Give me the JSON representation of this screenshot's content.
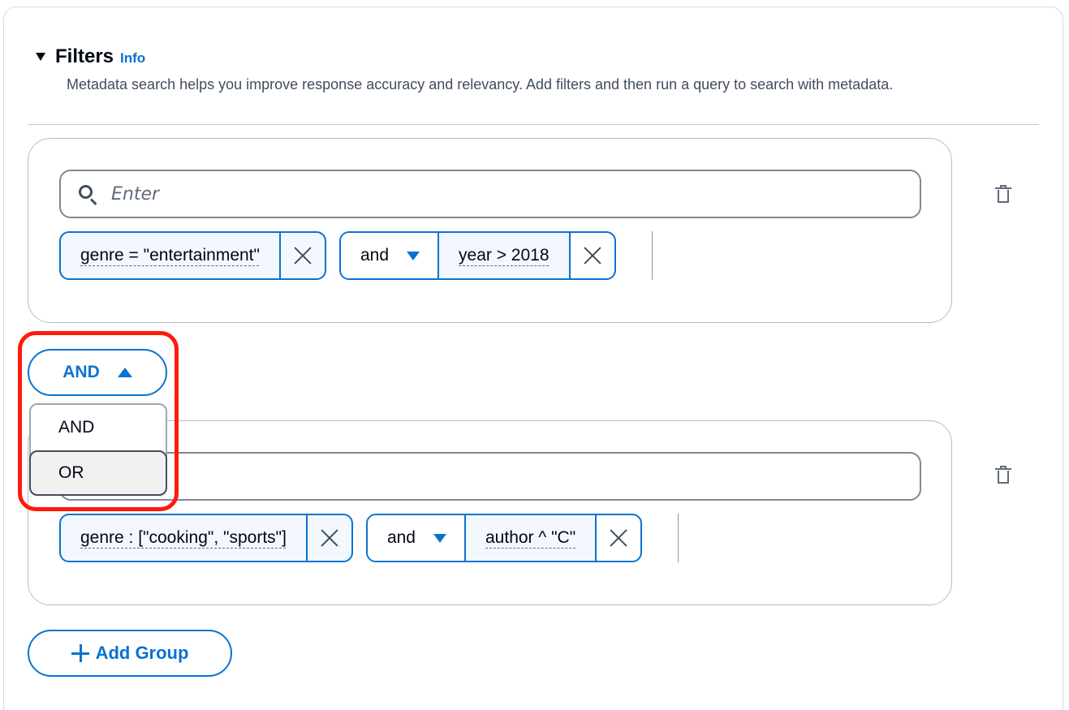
{
  "filters": {
    "title": "Filters",
    "info_label": "Info",
    "description": "Metadata search helps you improve response accuracy and relevancy. Add filters and then run a query to search with metadata."
  },
  "groups": [
    {
      "search_placeholder": "Enter",
      "tokens": [
        {
          "label": "genre = \"entertainment\""
        },
        {
          "operator": "and",
          "label": "year > 2018"
        }
      ]
    },
    {
      "search_placeholder": "",
      "tokens": [
        {
          "label": "genre : [\"cooking\", \"sports\"]"
        },
        {
          "operator": "and",
          "label": "author ^ \"C\""
        }
      ]
    }
  ],
  "group_operator": {
    "selected": "AND",
    "options": [
      "AND",
      "OR"
    ],
    "highlighted_option": "OR"
  },
  "add_group_label": "Add Group",
  "colors": {
    "accent": "#0972d3",
    "highlight_outline": "#ff1a0c",
    "text": "#000716"
  }
}
